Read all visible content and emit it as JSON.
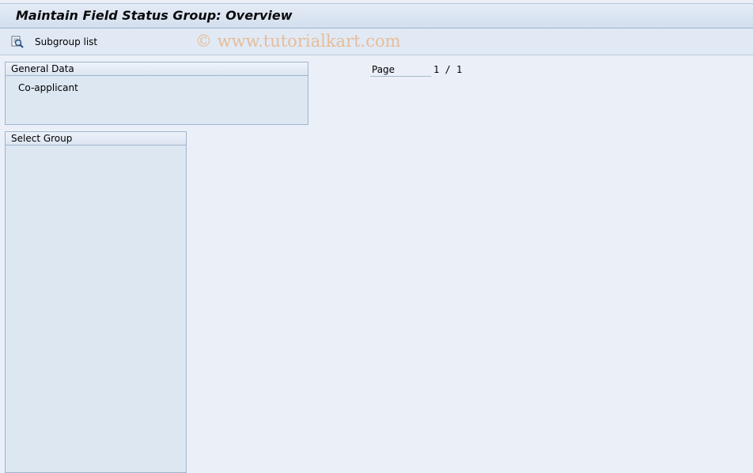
{
  "window": {
    "title": "Maintain Field Status Group: Overview"
  },
  "toolbar": {
    "subgroup_list_label": "Subgroup list",
    "subgroup_list_icon": "magnifier-list-icon"
  },
  "watermark": {
    "text": "© www.tutorialkart.com",
    "color": "#e8b68a"
  },
  "general_data": {
    "title": "General Data",
    "value": "Co-applicant"
  },
  "pagination": {
    "label": "Page",
    "current": "1",
    "separator": "/",
    "total": "1"
  },
  "select_group": {
    "title": "Select Group"
  },
  "colors": {
    "background": "#ebf0f8",
    "panel": "#dde7f2",
    "border": "#9fb5cf"
  }
}
